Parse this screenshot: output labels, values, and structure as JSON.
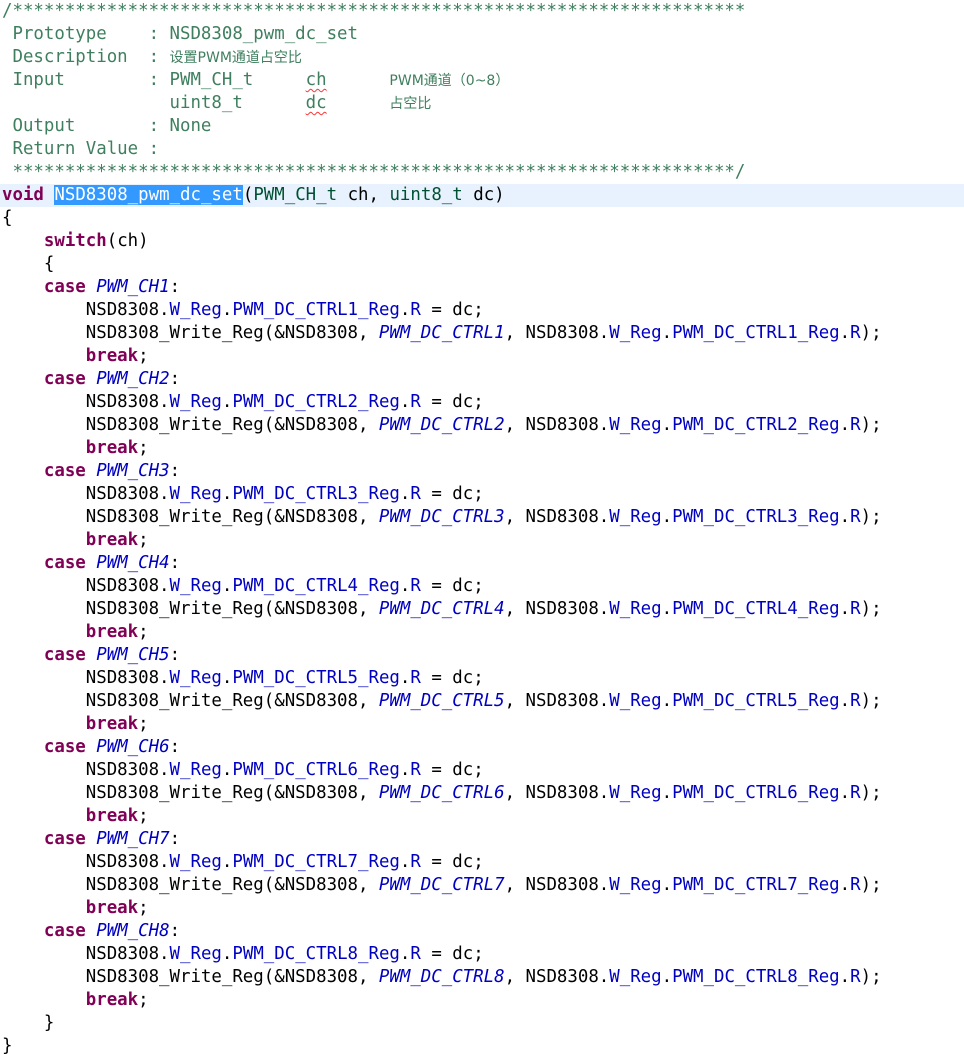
{
  "colors": {
    "background": "#ffffff",
    "comment": "#3f7f5f",
    "keyword": "#7f0055",
    "type": "#005032",
    "enum_constant": "#0000c0",
    "field": "#0000c0",
    "selection": "#3399ff",
    "current_line": "#e8f2fe",
    "spelling_squiggle": "#ff3333"
  },
  "code_lines": [
    [
      {
        "t": "/**********************************************************************",
        "c": "comment"
      }
    ],
    [
      {
        "t": " Prototype    : NSD8308_pwm_dc_set",
        "c": "comment"
      }
    ],
    [
      {
        "t": " Description  : ",
        "c": "comment"
      },
      {
        "t": "设置PWM通道占空比",
        "c": "comment cjk"
      }
    ],
    [
      {
        "t": " Input        : PWM_CH_t     ",
        "c": "comment"
      },
      {
        "t": "ch",
        "c": "comment squiggle"
      },
      {
        "t": "      ",
        "c": "comment"
      },
      {
        "t": "PWM通道（0~8）",
        "c": "comment cjk"
      }
    ],
    [
      {
        "t": "                uint8_t      ",
        "c": "comment"
      },
      {
        "t": "dc",
        "c": "comment squiggle"
      },
      {
        "t": "      ",
        "c": "comment"
      },
      {
        "t": "占空比",
        "c": "comment cjk"
      }
    ],
    [
      {
        "t": " Output       : None",
        "c": "comment"
      }
    ],
    [
      {
        "t": " Return Value :",
        "c": "comment"
      }
    ],
    [
      {
        "t": " *********************************************************************/",
        "c": "comment"
      }
    ],
    [
      {
        "t": "void",
        "c": "keyword"
      },
      {
        "t": " ",
        "c": ""
      },
      {
        "t": "NSD8308_pwm_dc_set",
        "c": "selected"
      },
      {
        "t": "(",
        "c": ""
      },
      {
        "t": "PWM_CH_t",
        "c": "type"
      },
      {
        "t": " ch, ",
        "c": ""
      },
      {
        "t": "uint8_t",
        "c": "type"
      },
      {
        "t": " dc)",
        "c": ""
      }
    ],
    [
      {
        "t": "{",
        "c": ""
      }
    ],
    [
      {
        "t": "    ",
        "c": ""
      },
      {
        "t": "switch",
        "c": "keyword"
      },
      {
        "t": "(ch)",
        "c": ""
      }
    ],
    [
      {
        "t": "    {",
        "c": ""
      }
    ],
    [
      {
        "t": "    ",
        "c": ""
      },
      {
        "t": "case",
        "c": "keyword"
      },
      {
        "t": " ",
        "c": ""
      },
      {
        "t": "PWM_CH1",
        "c": "enum"
      },
      {
        "t": ":",
        "c": ""
      }
    ],
    [
      {
        "t": "        NSD8308.",
        "c": ""
      },
      {
        "t": "W_Reg",
        "c": "member"
      },
      {
        "t": ".",
        "c": ""
      },
      {
        "t": "PWM_DC_CTRL1_Reg",
        "c": "member"
      },
      {
        "t": ".",
        "c": ""
      },
      {
        "t": "R",
        "c": "member"
      },
      {
        "t": " = dc;",
        "c": ""
      }
    ],
    [
      {
        "t": "        NSD8308_Write_Reg(&NSD8308, ",
        "c": ""
      },
      {
        "t": "PWM_DC_CTRL1",
        "c": "enum"
      },
      {
        "t": ", NSD8308.",
        "c": ""
      },
      {
        "t": "W_Reg",
        "c": "member"
      },
      {
        "t": ".",
        "c": ""
      },
      {
        "t": "PWM_DC_CTRL1_Reg",
        "c": "member"
      },
      {
        "t": ".",
        "c": ""
      },
      {
        "t": "R",
        "c": "member"
      },
      {
        "t": ");",
        "c": ""
      }
    ],
    [
      {
        "t": "        ",
        "c": ""
      },
      {
        "t": "break",
        "c": "keyword"
      },
      {
        "t": ";",
        "c": ""
      }
    ],
    [
      {
        "t": "    ",
        "c": ""
      },
      {
        "t": "case",
        "c": "keyword"
      },
      {
        "t": " ",
        "c": ""
      },
      {
        "t": "PWM_CH2",
        "c": "enum"
      },
      {
        "t": ":",
        "c": ""
      }
    ],
    [
      {
        "t": "        NSD8308.",
        "c": ""
      },
      {
        "t": "W_Reg",
        "c": "member"
      },
      {
        "t": ".",
        "c": ""
      },
      {
        "t": "PWM_DC_CTRL2_Reg",
        "c": "member"
      },
      {
        "t": ".",
        "c": ""
      },
      {
        "t": "R",
        "c": "member"
      },
      {
        "t": " = dc;",
        "c": ""
      }
    ],
    [
      {
        "t": "        NSD8308_Write_Reg(&NSD8308, ",
        "c": ""
      },
      {
        "t": "PWM_DC_CTRL2",
        "c": "enum"
      },
      {
        "t": ", NSD8308.",
        "c": ""
      },
      {
        "t": "W_Reg",
        "c": "member"
      },
      {
        "t": ".",
        "c": ""
      },
      {
        "t": "PWM_DC_CTRL2_Reg",
        "c": "member"
      },
      {
        "t": ".",
        "c": ""
      },
      {
        "t": "R",
        "c": "member"
      },
      {
        "t": ");",
        "c": ""
      }
    ],
    [
      {
        "t": "        ",
        "c": ""
      },
      {
        "t": "break",
        "c": "keyword"
      },
      {
        "t": ";",
        "c": ""
      }
    ],
    [
      {
        "t": "    ",
        "c": ""
      },
      {
        "t": "case",
        "c": "keyword"
      },
      {
        "t": " ",
        "c": ""
      },
      {
        "t": "PWM_CH3",
        "c": "enum"
      },
      {
        "t": ":",
        "c": ""
      }
    ],
    [
      {
        "t": "        NSD8308.",
        "c": ""
      },
      {
        "t": "W_Reg",
        "c": "member"
      },
      {
        "t": ".",
        "c": ""
      },
      {
        "t": "PWM_DC_CTRL3_Reg",
        "c": "member"
      },
      {
        "t": ".",
        "c": ""
      },
      {
        "t": "R",
        "c": "member"
      },
      {
        "t": " = dc;",
        "c": ""
      }
    ],
    [
      {
        "t": "        NSD8308_Write_Reg(&NSD8308, ",
        "c": ""
      },
      {
        "t": "PWM_DC_CTRL3",
        "c": "enum"
      },
      {
        "t": ", NSD8308.",
        "c": ""
      },
      {
        "t": "W_Reg",
        "c": "member"
      },
      {
        "t": ".",
        "c": ""
      },
      {
        "t": "PWM_DC_CTRL3_Reg",
        "c": "member"
      },
      {
        "t": ".",
        "c": ""
      },
      {
        "t": "R",
        "c": "member"
      },
      {
        "t": ");",
        "c": ""
      }
    ],
    [
      {
        "t": "        ",
        "c": ""
      },
      {
        "t": "break",
        "c": "keyword"
      },
      {
        "t": ";",
        "c": ""
      }
    ],
    [
      {
        "t": "    ",
        "c": ""
      },
      {
        "t": "case",
        "c": "keyword"
      },
      {
        "t": " ",
        "c": ""
      },
      {
        "t": "PWM_CH4",
        "c": "enum"
      },
      {
        "t": ":",
        "c": ""
      }
    ],
    [
      {
        "t": "        NSD8308.",
        "c": ""
      },
      {
        "t": "W_Reg",
        "c": "member"
      },
      {
        "t": ".",
        "c": ""
      },
      {
        "t": "PWM_DC_CTRL4_Reg",
        "c": "member"
      },
      {
        "t": ".",
        "c": ""
      },
      {
        "t": "R",
        "c": "member"
      },
      {
        "t": " = dc;",
        "c": ""
      }
    ],
    [
      {
        "t": "        NSD8308_Write_Reg(&NSD8308, ",
        "c": ""
      },
      {
        "t": "PWM_DC_CTRL4",
        "c": "enum"
      },
      {
        "t": ", NSD8308.",
        "c": ""
      },
      {
        "t": "W_Reg",
        "c": "member"
      },
      {
        "t": ".",
        "c": ""
      },
      {
        "t": "PWM_DC_CTRL4_Reg",
        "c": "member"
      },
      {
        "t": ".",
        "c": ""
      },
      {
        "t": "R",
        "c": "member"
      },
      {
        "t": ");",
        "c": ""
      }
    ],
    [
      {
        "t": "        ",
        "c": ""
      },
      {
        "t": "break",
        "c": "keyword"
      },
      {
        "t": ";",
        "c": ""
      }
    ],
    [
      {
        "t": "    ",
        "c": ""
      },
      {
        "t": "case",
        "c": "keyword"
      },
      {
        "t": " ",
        "c": ""
      },
      {
        "t": "PWM_CH5",
        "c": "enum"
      },
      {
        "t": ":",
        "c": ""
      }
    ],
    [
      {
        "t": "        NSD8308.",
        "c": ""
      },
      {
        "t": "W_Reg",
        "c": "member"
      },
      {
        "t": ".",
        "c": ""
      },
      {
        "t": "PWM_DC_CTRL5_Reg",
        "c": "member"
      },
      {
        "t": ".",
        "c": ""
      },
      {
        "t": "R",
        "c": "member"
      },
      {
        "t": " = dc;",
        "c": ""
      }
    ],
    [
      {
        "t": "        NSD8308_Write_Reg(&NSD8308, ",
        "c": ""
      },
      {
        "t": "PWM_DC_CTRL5",
        "c": "enum"
      },
      {
        "t": ", NSD8308.",
        "c": ""
      },
      {
        "t": "W_Reg",
        "c": "member"
      },
      {
        "t": ".",
        "c": ""
      },
      {
        "t": "PWM_DC_CTRL5_Reg",
        "c": "member"
      },
      {
        "t": ".",
        "c": ""
      },
      {
        "t": "R",
        "c": "member"
      },
      {
        "t": ");",
        "c": ""
      }
    ],
    [
      {
        "t": "        ",
        "c": ""
      },
      {
        "t": "break",
        "c": "keyword"
      },
      {
        "t": ";",
        "c": ""
      }
    ],
    [
      {
        "t": "    ",
        "c": ""
      },
      {
        "t": "case",
        "c": "keyword"
      },
      {
        "t": " ",
        "c": ""
      },
      {
        "t": "PWM_CH6",
        "c": "enum"
      },
      {
        "t": ":",
        "c": ""
      }
    ],
    [
      {
        "t": "        NSD8308.",
        "c": ""
      },
      {
        "t": "W_Reg",
        "c": "member"
      },
      {
        "t": ".",
        "c": ""
      },
      {
        "t": "PWM_DC_CTRL6_Reg",
        "c": "member"
      },
      {
        "t": ".",
        "c": ""
      },
      {
        "t": "R",
        "c": "member"
      },
      {
        "t": " = dc;",
        "c": ""
      }
    ],
    [
      {
        "t": "        NSD8308_Write_Reg(&NSD8308, ",
        "c": ""
      },
      {
        "t": "PWM_DC_CTRL6",
        "c": "enum"
      },
      {
        "t": ", NSD8308.",
        "c": ""
      },
      {
        "t": "W_Reg",
        "c": "member"
      },
      {
        "t": ".",
        "c": ""
      },
      {
        "t": "PWM_DC_CTRL6_Reg",
        "c": "member"
      },
      {
        "t": ".",
        "c": ""
      },
      {
        "t": "R",
        "c": "member"
      },
      {
        "t": ");",
        "c": ""
      }
    ],
    [
      {
        "t": "        ",
        "c": ""
      },
      {
        "t": "break",
        "c": "keyword"
      },
      {
        "t": ";",
        "c": ""
      }
    ],
    [
      {
        "t": "    ",
        "c": ""
      },
      {
        "t": "case",
        "c": "keyword"
      },
      {
        "t": " ",
        "c": ""
      },
      {
        "t": "PWM_CH7",
        "c": "enum"
      },
      {
        "t": ":",
        "c": ""
      }
    ],
    [
      {
        "t": "        NSD8308.",
        "c": ""
      },
      {
        "t": "W_Reg",
        "c": "member"
      },
      {
        "t": ".",
        "c": ""
      },
      {
        "t": "PWM_DC_CTRL7_Reg",
        "c": "member"
      },
      {
        "t": ".",
        "c": ""
      },
      {
        "t": "R",
        "c": "member"
      },
      {
        "t": " = dc;",
        "c": ""
      }
    ],
    [
      {
        "t": "        NSD8308_Write_Reg(&NSD8308, ",
        "c": ""
      },
      {
        "t": "PWM_DC_CTRL7",
        "c": "enum"
      },
      {
        "t": ", NSD8308.",
        "c": ""
      },
      {
        "t": "W_Reg",
        "c": "member"
      },
      {
        "t": ".",
        "c": ""
      },
      {
        "t": "PWM_DC_CTRL7_Reg",
        "c": "member"
      },
      {
        "t": ".",
        "c": ""
      },
      {
        "t": "R",
        "c": "member"
      },
      {
        "t": ");",
        "c": ""
      }
    ],
    [
      {
        "t": "        ",
        "c": ""
      },
      {
        "t": "break",
        "c": "keyword"
      },
      {
        "t": ";",
        "c": ""
      }
    ],
    [
      {
        "t": "    ",
        "c": ""
      },
      {
        "t": "case",
        "c": "keyword"
      },
      {
        "t": " ",
        "c": ""
      },
      {
        "t": "PWM_CH8",
        "c": "enum"
      },
      {
        "t": ":",
        "c": ""
      }
    ],
    [
      {
        "t": "        NSD8308.",
        "c": ""
      },
      {
        "t": "W_Reg",
        "c": "member"
      },
      {
        "t": ".",
        "c": ""
      },
      {
        "t": "PWM_DC_CTRL8_Reg",
        "c": "member"
      },
      {
        "t": ".",
        "c": ""
      },
      {
        "t": "R",
        "c": "member"
      },
      {
        "t": " = dc;",
        "c": ""
      }
    ],
    [
      {
        "t": "        NSD8308_Write_Reg(&NSD8308, ",
        "c": ""
      },
      {
        "t": "PWM_DC_CTRL8",
        "c": "enum"
      },
      {
        "t": ", NSD8308.",
        "c": ""
      },
      {
        "t": "W_Reg",
        "c": "member"
      },
      {
        "t": ".",
        "c": ""
      },
      {
        "t": "PWM_DC_CTRL8_Reg",
        "c": "member"
      },
      {
        "t": ".",
        "c": ""
      },
      {
        "t": "R",
        "c": "member"
      },
      {
        "t": ");",
        "c": ""
      }
    ],
    [
      {
        "t": "        ",
        "c": ""
      },
      {
        "t": "break",
        "c": "keyword"
      },
      {
        "t": ";",
        "c": ""
      }
    ],
    [
      {
        "t": "    }",
        "c": ""
      }
    ],
    [
      {
        "t": "}",
        "c": ""
      }
    ]
  ],
  "current_line_index": 8
}
